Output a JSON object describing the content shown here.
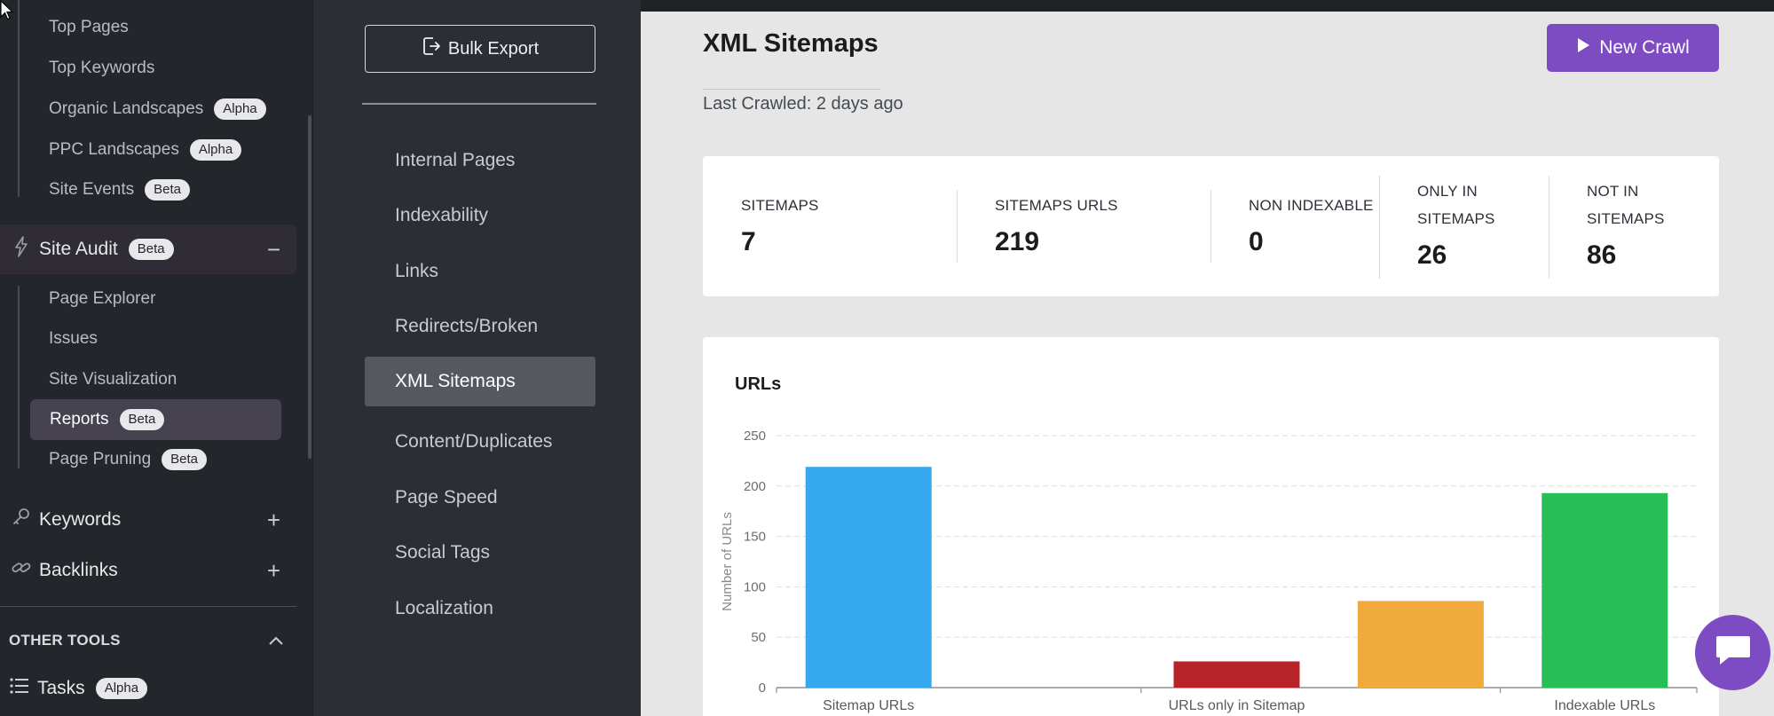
{
  "sidebar": {
    "seo_items": [
      {
        "label": "Top Pages",
        "badge": ""
      },
      {
        "label": "Top Keywords",
        "badge": ""
      },
      {
        "label": "Organic Landscapes",
        "badge": "Alpha"
      },
      {
        "label": "PPC Landscapes",
        "badge": "Alpha"
      },
      {
        "label": "Site Events",
        "badge": "Beta"
      }
    ],
    "site_audit": {
      "label": "Site Audit",
      "badge": "Beta",
      "toggle": "−",
      "icon": "lightning-icon"
    },
    "audit_items": [
      {
        "label": "Page Explorer",
        "badge": ""
      },
      {
        "label": "Issues",
        "badge": ""
      },
      {
        "label": "Site Visualization",
        "badge": ""
      },
      {
        "label": "Reports",
        "badge": "Beta"
      },
      {
        "label": "Page Pruning",
        "badge": "Beta"
      }
    ],
    "keywords": {
      "label": "Keywords",
      "toggle": "+",
      "icon": "key-icon"
    },
    "backlinks": {
      "label": "Backlinks",
      "toggle": "+",
      "icon": "link-icon"
    },
    "other_tools": {
      "label": "OTHER TOOLS",
      "icon": "chevron-up-icon"
    },
    "tasks": {
      "label": "Tasks",
      "badge": "Alpha",
      "icon": "list-icon"
    }
  },
  "midpanel": {
    "bulk_export_label": "Bulk Export",
    "items": [
      "Internal Pages",
      "Indexability",
      "Links",
      "Redirects/Broken",
      "XML Sitemaps",
      "Content/Duplicates",
      "Page Speed",
      "Social Tags",
      "Localization"
    ],
    "active_item": "XML Sitemaps"
  },
  "main": {
    "title": "XML Sitemaps",
    "last_crawled": "Last Crawled: 2 days ago",
    "new_crawl_label": "New Crawl",
    "stats": [
      {
        "label": "SITEMAPS",
        "value": "7"
      },
      {
        "label": "SITEMAPS URLS",
        "value": "219"
      },
      {
        "label": "NON INDEXABLE",
        "value": "0"
      },
      {
        "label": "ONLY IN SITEMAPS",
        "label_line1": "ONLY IN",
        "label_line2": "SITEMAPS",
        "value": "26"
      },
      {
        "label": "NOT IN SITEMAPS",
        "label_line1": "NOT IN",
        "label_line2": "SITEMAPS",
        "value": "86"
      }
    ]
  },
  "chart_data": {
    "type": "bar",
    "title": "URLs",
    "ylabel": "Number of URLs",
    "xlabel": "",
    "ylim": [
      0,
      250
    ],
    "yticks": [
      0,
      50,
      100,
      150,
      200,
      250
    ],
    "grid": true,
    "x_tick_labels": [
      "Sitemap URLs",
      "URLs only in Sitemap",
      "Indexable URLs"
    ],
    "bars": [
      {
        "value": 219,
        "color": "#35a8f0"
      },
      {
        "value": 0,
        "color": "#8e44ad"
      },
      {
        "value": 26,
        "color": "#b8232a"
      },
      {
        "value": 86,
        "color": "#f0ab3c"
      },
      {
        "value": 193,
        "color": "#27be55"
      }
    ]
  },
  "colors": {
    "accent": "#7d4cc3",
    "sidebar_bg": "#23262b",
    "panel_bg": "#2b2e34"
  }
}
